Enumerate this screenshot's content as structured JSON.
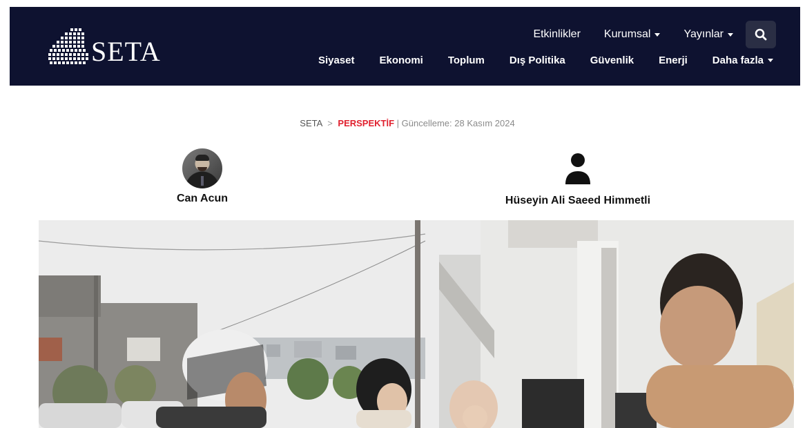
{
  "header": {
    "logo_text": "SETA",
    "top_nav": [
      {
        "label": "Etkinlikler",
        "dropdown": false
      },
      {
        "label": "Kurumsal",
        "dropdown": true
      },
      {
        "label": "Yayınlar",
        "dropdown": true
      }
    ],
    "search_icon": "search-icon",
    "main_nav": [
      {
        "label": "Siyaset",
        "dropdown": false
      },
      {
        "label": "Ekonomi",
        "dropdown": false
      },
      {
        "label": "Toplum",
        "dropdown": false
      },
      {
        "label": "Dış Politika",
        "dropdown": false
      },
      {
        "label": "Güvenlik",
        "dropdown": false
      },
      {
        "label": "Enerji",
        "dropdown": false
      },
      {
        "label": "Daha fazla",
        "dropdown": true
      }
    ]
  },
  "breadcrumb": {
    "home": "SETA",
    "separator": ">",
    "category": "PERSPEKTİF",
    "divider": "|",
    "updated": "Güncelleme: 28 Kasım 2024"
  },
  "authors": [
    {
      "name": "Can Acun",
      "avatar": "photo"
    },
    {
      "name": "Hüseyin Ali Saeed Himmetli",
      "avatar": "user-icon"
    }
  ],
  "colors": {
    "header_bg": "#0e1230",
    "accent_red": "#e0202e",
    "search_bg": "#2a2e44"
  }
}
